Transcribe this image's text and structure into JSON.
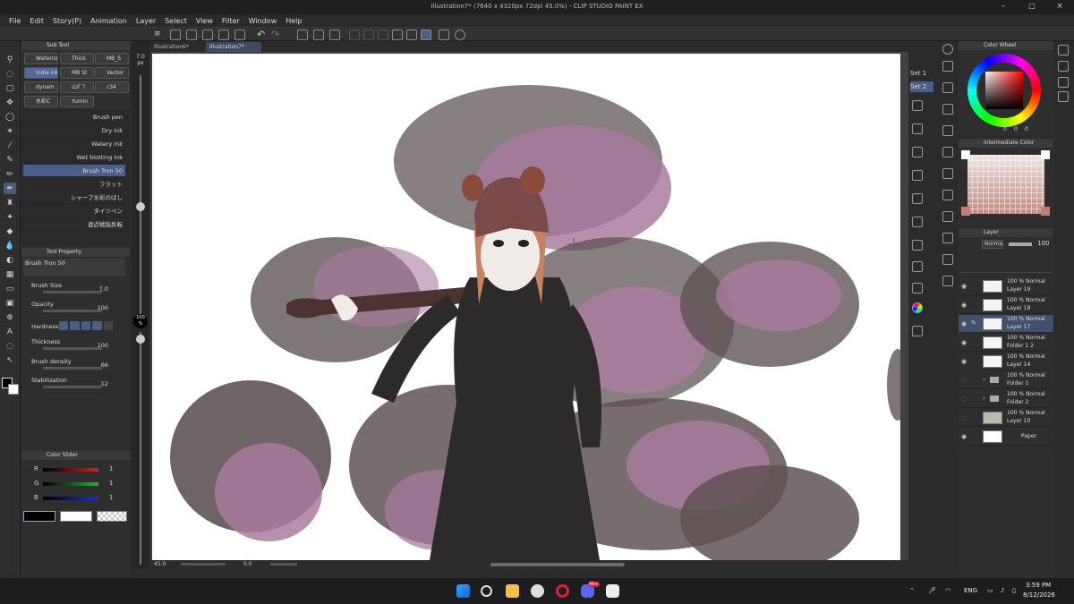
{
  "window": {
    "title": "Illustration7* (7640 x 4320px 72dpi 45.0%) - CLIP STUDIO PAINT EX"
  },
  "menu": [
    "File",
    "Edit",
    "Story(P)",
    "Animation",
    "Layer",
    "Select",
    "View",
    "Filter",
    "Window",
    "Help"
  ],
  "doc_tabs": [
    {
      "label": "Illustration6*",
      "active": false
    },
    {
      "label": "Illustration7*",
      "active": true
    }
  ],
  "subtool": {
    "title": "Sub Tool",
    "tabs": [
      "Watercolor",
      "Thick",
      "MB_S",
      "India ink",
      "MB St",
      "Vector",
      "dynam",
      "山ﾀﾞﾗ",
      "c34",
      "水彩C",
      "Yumin"
    ],
    "brushes": [
      "Brush pen",
      "Dry ink",
      "Watery ink",
      "Wet blotting ink",
      "Brush Tron 50",
      "フラット",
      "シャープ水彩のばし",
      "タイツペン",
      "遠近戦指反転"
    ],
    "selected_brush_index": 4
  },
  "tool_property": {
    "title": "Tool Property",
    "brush_name": "Brush Tron 50",
    "props": [
      {
        "label": "Brush Size",
        "value": "7.0"
      },
      {
        "label": "Opacity",
        "value": "100"
      },
      {
        "label": "Hardness",
        "value": ""
      },
      {
        "label": "Thickness",
        "value": "100"
      },
      {
        "label": "Brush density",
        "value": "66"
      },
      {
        "label": "Stabilization",
        "value": "12"
      }
    ]
  },
  "color_slider": {
    "title": "Color Slider",
    "channels": [
      {
        "label": "R",
        "value": "1",
        "color": "#d42020"
      },
      {
        "label": "G",
        "value": "1",
        "color": "#20b040"
      },
      {
        "label": "B",
        "value": "1",
        "color": "#2030d0"
      }
    ]
  },
  "zoom_slider": {
    "size_label": "7.0",
    "size_unit": "px",
    "opacity_label": "100",
    "opacity_unit": "%"
  },
  "status": {
    "zoom": "45.0",
    "angle": "0.0"
  },
  "right_sets": [
    "Set 1",
    "Set 2"
  ],
  "color_wheel": {
    "title": "Color Wheel",
    "values": [
      "0",
      "0",
      "0"
    ]
  },
  "intermediate_color": {
    "title": "Intermediate Color"
  },
  "layers": {
    "title": "Layer",
    "blend_mode": "Normal",
    "opacity": "100",
    "items": [
      {
        "mode": "100 % Normal",
        "name": "Layer 19",
        "selected": false,
        "folder": false
      },
      {
        "mode": "100 % Normal",
        "name": "Layer 18",
        "selected": false,
        "folder": false
      },
      {
        "mode": "100 % Normal",
        "name": "Layer 17",
        "selected": true,
        "folder": false
      },
      {
        "mode": "100 % Normal",
        "name": "Folder 1 2",
        "selected": false,
        "folder": false
      },
      {
        "mode": "100 % Normal",
        "name": "Layer 14",
        "selected": false,
        "folder": false
      },
      {
        "mode": "100 % Normal",
        "name": "Folder 1",
        "selected": false,
        "folder": true
      },
      {
        "mode": "100 % Normal",
        "name": "Folder 2",
        "selected": false,
        "folder": true
      },
      {
        "mode": "100 % Normal",
        "name": "Layer 10",
        "selected": false,
        "folder": false
      },
      {
        "mode": "",
        "name": "Paper",
        "selected": false,
        "folder": false
      }
    ]
  },
  "taskbar": {
    "lang": "ENG",
    "time": "3:59 PM",
    "date": "8/12/2026",
    "discord_badge": "99+"
  },
  "colors": {
    "smoke_dark": "#4a3c3d",
    "smoke_pink": "#9e6a92",
    "accent": "#4b5f86"
  }
}
